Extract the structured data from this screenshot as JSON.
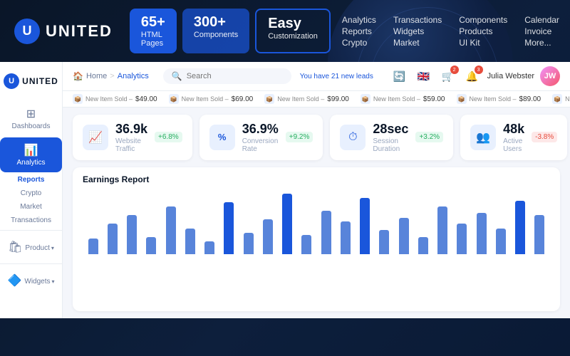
{
  "brand": {
    "logo_letter": "U",
    "name": "UNITED"
  },
  "stats": [
    {
      "big": "65+",
      "label": "HTML Pages"
    },
    {
      "big": "300+",
      "label": "Components"
    },
    {
      "big": "Easy",
      "label": "Customization"
    }
  ],
  "nav": [
    {
      "col": [
        "Analytics",
        "Reports",
        "Crypto"
      ]
    },
    {
      "col": [
        "Transactions",
        "Widgets",
        "Market"
      ]
    },
    {
      "col": [
        "Components",
        "Products",
        "UI Kit"
      ]
    },
    {
      "col": [
        "Calendar",
        "Invoice",
        "More..."
      ]
    }
  ],
  "sidebar": {
    "logo_letter": "U",
    "logo_text": "UNITED",
    "items": [
      {
        "icon": "⊞",
        "label": "Dashboards",
        "active": false
      },
      {
        "icon": "📊",
        "label": "Analytics",
        "active": true
      },
      {
        "sub": [
          "Reports",
          "Crypto",
          "Market",
          "Transactions"
        ]
      },
      {
        "group_icon": "🛍",
        "group_label": "Product",
        "active": false
      },
      {
        "group_icon": "🔷",
        "group_label": "Widgets",
        "active": false
      }
    ]
  },
  "header": {
    "breadcrumb": {
      "home": "Home",
      "sep": ">",
      "current": "Analytics"
    },
    "search_placeholder": "Search",
    "leads_text": "You have 21 new leads",
    "user_name": "Julia Webster",
    "icons": [
      "🔄",
      "🌐",
      "🛒",
      "🔔"
    ]
  },
  "ticker": [
    {
      "icon": "📦",
      "label": "New Item Sold –",
      "price": "$49.00"
    },
    {
      "icon": "📦",
      "label": "New Item Sold –",
      "price": "$69.00"
    },
    {
      "icon": "📦",
      "label": "New Item Sold –",
      "price": "$99.00"
    },
    {
      "icon": "📦",
      "label": "New Item Sold –",
      "price": "$59.00"
    },
    {
      "icon": "📦",
      "label": "New Item Sold –",
      "price": "$89.00"
    },
    {
      "icon": "📦",
      "label": "New Item Sold –",
      "price": "$..."
    }
  ],
  "stat_cards": [
    {
      "icon": "📈",
      "value": "36.9k",
      "label": "Website Traffic",
      "change": "+6.8%",
      "trend": "up"
    },
    {
      "icon": "%",
      "value": "36.9%",
      "label": "Conversion Rate",
      "change": "+9.2%",
      "trend": "up"
    },
    {
      "icon": "⏱",
      "value": "28sec",
      "label": "Session Duration",
      "change": "+3.2%",
      "trend": "up"
    },
    {
      "icon": "👥",
      "value": "48k",
      "label": "Active Users",
      "change": "-3.8%",
      "trend": "down"
    }
  ],
  "chart": {
    "title": "Earnings Report",
    "bars": [
      18,
      35,
      45,
      20,
      55,
      30,
      15,
      60,
      25,
      40,
      70,
      22,
      50,
      38,
      65,
      28,
      42,
      20,
      55,
      35,
      48,
      30,
      62,
      45
    ]
  }
}
